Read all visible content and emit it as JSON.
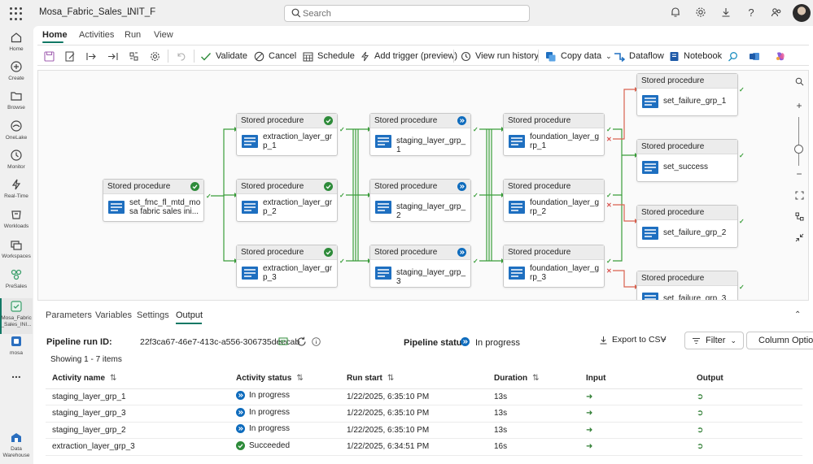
{
  "app": {
    "title": "Mosa_Fabric_Sales_INIT_F",
    "search_placeholder": "Search"
  },
  "leftnav": [
    {
      "label": "Home",
      "icon": "home-icon"
    },
    {
      "label": "Create",
      "icon": "create-icon"
    },
    {
      "label": "Browse",
      "icon": "folder-icon"
    },
    {
      "label": "OneLake",
      "icon": "onelake-icon"
    },
    {
      "label": "Monitor",
      "icon": "monitor-icon"
    },
    {
      "label": "Real-Time",
      "icon": "lightning-icon"
    },
    {
      "label": "Workloads",
      "icon": "workloads-icon"
    },
    {
      "label": "Workspaces",
      "icon": "workspaces-icon"
    },
    {
      "label": "PreSales",
      "icon": "presales-icon"
    },
    {
      "label": "Mosa_Fabric _Sales_INI...",
      "icon": "pipeline-icon"
    },
    {
      "label": "mosa",
      "icon": "workspace-icon"
    },
    {
      "label": "...",
      "icon": "more-icon"
    },
    {
      "label": "Data Warehouse",
      "icon": "data-warehouse-icon"
    }
  ],
  "tabs": [
    "Home",
    "Activities",
    "Run",
    "View"
  ],
  "toolbar": {
    "validate": "Validate",
    "cancel": "Cancel",
    "schedule": "Schedule",
    "add_trigger": "Add trigger (preview)",
    "view_run_history": "View run history",
    "copy_data": "Copy data",
    "dataflow": "Dataflow",
    "notebook": "Notebook"
  },
  "node_header": "Stored procedure",
  "nodes": {
    "init": {
      "name": "set_fmc_fl_mtd_mo sa fabric sales ini...",
      "status": "succeeded"
    },
    "extraction_1": {
      "name": "extraction_layer_gr p_1",
      "status": "succeeded"
    },
    "extraction_2": {
      "name": "extraction_layer_gr p_2",
      "status": "succeeded"
    },
    "extraction_3": {
      "name": "extraction_layer_gr p_3",
      "status": "succeeded"
    },
    "staging_1": {
      "name": "staging_layer_grp_1",
      "status": "in-progress"
    },
    "staging_2": {
      "name": "staging_layer_grp_2",
      "status": "in-progress"
    },
    "staging_3": {
      "name": "staging_layer_grp_3",
      "status": "in-progress"
    },
    "foundation_1": {
      "name": "foundation_layer_g rp_1",
      "status": "none"
    },
    "foundation_2": {
      "name": "foundation_layer_g rp_2",
      "status": "none"
    },
    "foundation_3": {
      "name": "foundation_layer_g rp_3",
      "status": "none"
    },
    "failure_1": {
      "name": "set_failure_grp_1",
      "status": "none"
    },
    "success": {
      "name": "set_success",
      "status": "none"
    },
    "failure_2": {
      "name": "set_failure_grp_2",
      "status": "none"
    },
    "failure_3": {
      "name": "set_failure_grp_3",
      "status": "none"
    }
  },
  "panel": {
    "tabs": [
      "Parameters",
      "Variables",
      "Settings",
      "Output"
    ],
    "active_tab": "Output",
    "run_id_label": "Pipeline run ID:",
    "run_id": "22f3ca67-46e7-413c-a556-306735deecab",
    "status_label": "Pipeline status",
    "status": "In progress",
    "export": "Export to CSV",
    "filter": "Filter",
    "column_options": "Column Options",
    "showing": "Showing 1 - 7 items",
    "columns": [
      "Activity name",
      "Activity status",
      "Run start",
      "Duration",
      "Input",
      "Output"
    ],
    "rows": [
      {
        "name": "staging_layer_grp_1",
        "status": "In progress",
        "start": "1/22/2025, 6:35:10 PM",
        "duration": "13s"
      },
      {
        "name": "staging_layer_grp_3",
        "status": "In progress",
        "start": "1/22/2025, 6:35:10 PM",
        "duration": "13s"
      },
      {
        "name": "staging_layer_grp_2",
        "status": "In progress",
        "start": "1/22/2025, 6:35:10 PM",
        "duration": "13s"
      },
      {
        "name": "extraction_layer_grp_3",
        "status": "Succeeded",
        "start": "1/22/2025, 6:34:51 PM",
        "duration": "16s"
      }
    ]
  },
  "colors": {
    "accent": "#117865",
    "success": "#2e8b3a",
    "progress": "#0f6cbd",
    "failure_link": "#d9534f"
  }
}
